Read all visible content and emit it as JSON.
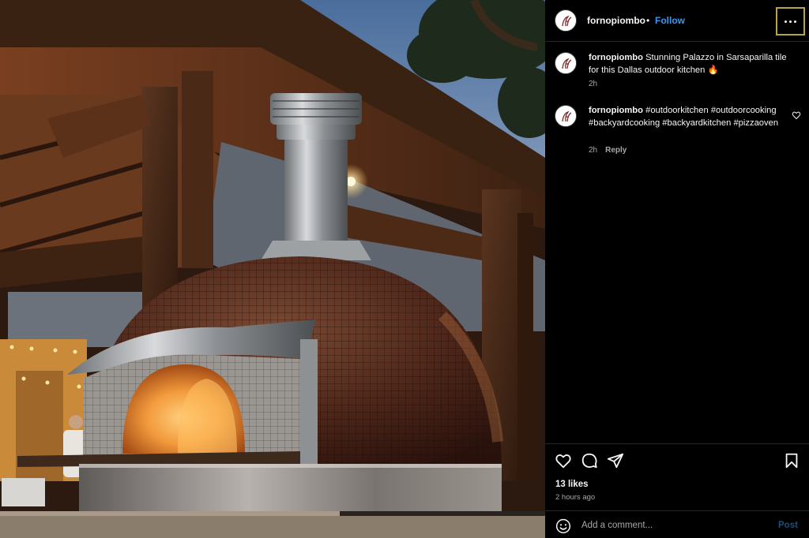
{
  "post": {
    "image_alt": "",
    "username": "fornopiombo",
    "follow_label": "Follow",
    "separator": "•",
    "more_icon": "more-horizontal-icon"
  },
  "comments": [
    {
      "username": "fornopiombo",
      "text": "Stunning Palazzo in Sarsaparilla tile for this Dallas outdoor kitchen 🔥",
      "time": "2h",
      "reply_label": ""
    },
    {
      "username": "fornopiombo",
      "text": "#outdoorkitchen #outdoorcooking #backyardcooking #backyardkitchen #pizzaoven",
      "time": "2h",
      "reply_label": "Reply"
    }
  ],
  "actions": {
    "like_icon": "heart-icon",
    "comment_icon": "comment-bubble-icon",
    "share_icon": "send-icon",
    "save_icon": "bookmark-icon",
    "likes_text": "13 likes",
    "time_ago": "2 hours ago"
  },
  "add_comment": {
    "placeholder": "Add a comment...",
    "post_label": "Post",
    "emoji_icon": "emoji-icon"
  },
  "colors": {
    "background": "#000000",
    "link_blue": "#3897f0",
    "post_disabled": "#1c4f7c",
    "secondary_text": "#a8a8a8",
    "focus_outline": "#b9a24c"
  }
}
